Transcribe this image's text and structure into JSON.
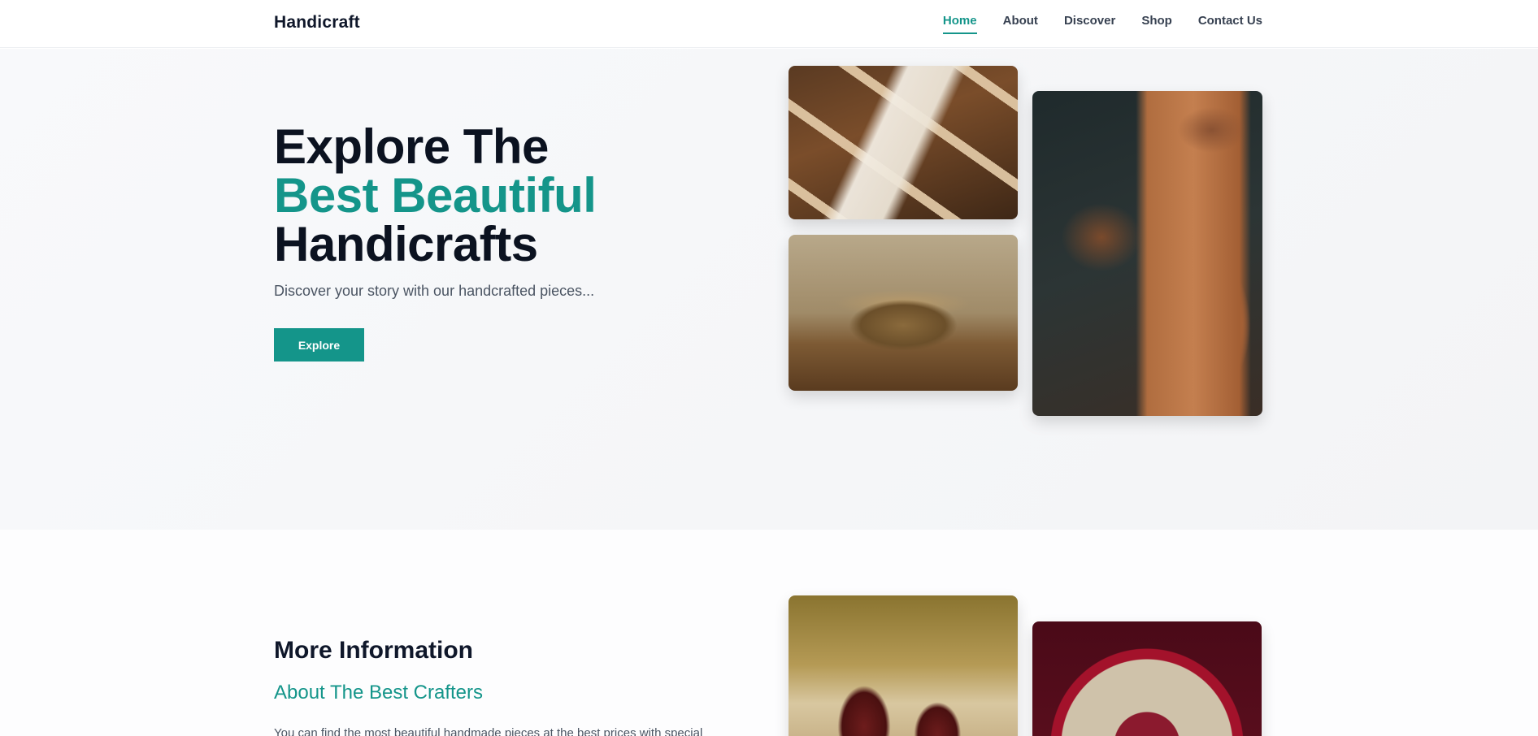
{
  "header": {
    "brand": "Handicraft",
    "nav": [
      {
        "label": "Home",
        "active": true
      },
      {
        "label": "About",
        "active": false
      },
      {
        "label": "Discover",
        "active": false
      },
      {
        "label": "Shop",
        "active": false
      },
      {
        "label": "Contact Us",
        "active": false
      }
    ]
  },
  "hero": {
    "title_line1": "Explore The",
    "title_line2": "Best Beautiful",
    "title_line3": "Handicrafts",
    "subtitle": "Discover your story with our handcrafted pieces...",
    "button_label": "Explore",
    "images": [
      "clothespins-photo",
      "brass-bowl-photo",
      "pottery-wheel-photo"
    ]
  },
  "info": {
    "title": "More Information",
    "subtitle": "About The Best Crafters",
    "text": "You can find the most beautiful handmade pieces at the best prices with special",
    "images": [
      "ceramic-jars-photo",
      "embroidered-cushion-photo"
    ]
  },
  "colors": {
    "accent": "#14958a",
    "heading": "#0b1220",
    "body_text": "#4b5563"
  }
}
